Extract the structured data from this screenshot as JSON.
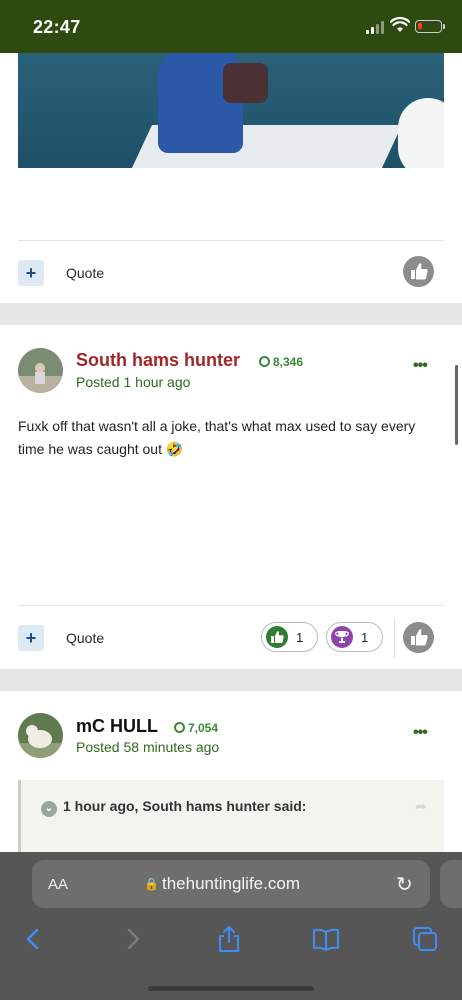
{
  "status_bar": {
    "time": "22:47"
  },
  "posts": [
    {
      "quote_label": "Quote"
    },
    {
      "author": "South hams hunter",
      "reputation": "8,346",
      "posted": "Posted 1 hour ago",
      "body": "Fuxk off that wasn't all a joke, that's what max used to say every time he was caught out 🤣",
      "quote_label": "Quote",
      "reactions": [
        {
          "type": "like",
          "count": "1",
          "color": "#2e7d32"
        },
        {
          "type": "trophy",
          "count": "1",
          "color": "#8e44ad"
        }
      ]
    },
    {
      "author": "mC HULL",
      "reputation": "7,054",
      "posted": "Posted 58 minutes ago",
      "quote_header": "1 hour ago, South hams hunter said:"
    }
  ],
  "browser": {
    "aa_label": "AA",
    "url": "thehuntinglife.com"
  },
  "colors": {
    "status_bar_bg": "#2f4a10",
    "author_name_red": "#a02727",
    "accent_green": "#2f6a1f",
    "toolbar_blue": "#3f8ef6"
  }
}
